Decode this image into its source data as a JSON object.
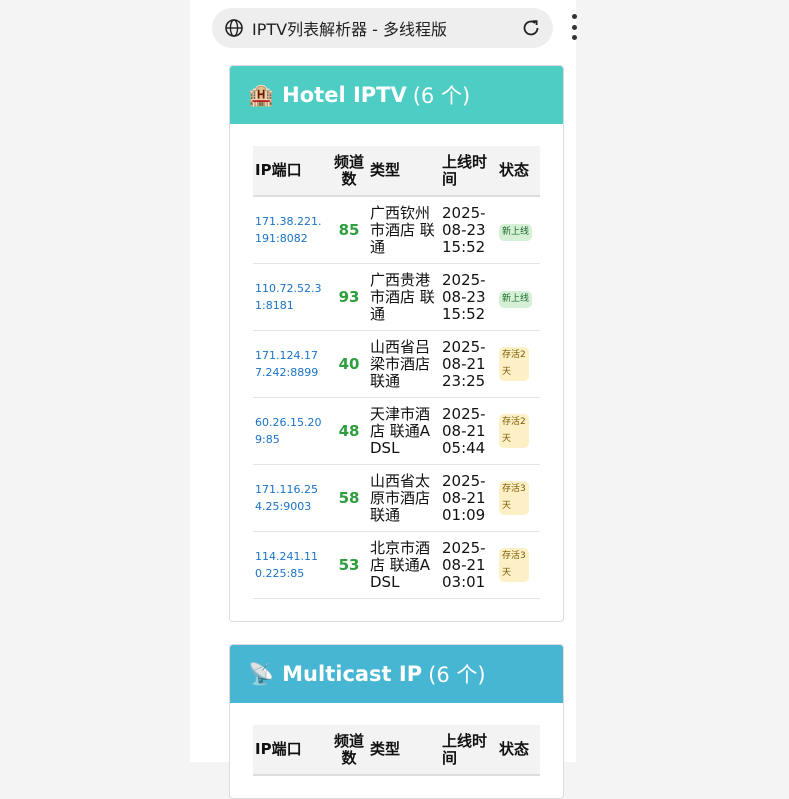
{
  "browser": {
    "title": "IPTV列表解析器 - 多线程版"
  },
  "hotel": {
    "emoji": "🏨",
    "name": "Hotel IPTV",
    "count": "(6 个)",
    "headers": {
      "ip": "IP端口",
      "channels": "频道数",
      "type": "类型",
      "online": "上线时间",
      "status": "状态"
    },
    "rows": [
      {
        "ip": "171.38.221.191:8082",
        "channels": "85",
        "type": "广西钦州市酒店 联通",
        "online": "2025-08-23 15:52",
        "status": "新上线",
        "kind": "new"
      },
      {
        "ip": "110.72.52.31:8181",
        "channels": "93",
        "type": "广西贵港市酒店 联通",
        "online": "2025-08-23 15:52",
        "status": "新上线",
        "kind": "new"
      },
      {
        "ip": "171.124.177.242:8899",
        "channels": "40",
        "type": "山西省吕梁市酒店联通",
        "online": "2025-08-21 23:25",
        "status": "存活2天",
        "kind": "alive"
      },
      {
        "ip": "60.26.15.209:85",
        "channels": "48",
        "type": "天津市酒店 联通ADSL",
        "online": "2025-08-21 05:44",
        "status": "存活2天",
        "kind": "alive"
      },
      {
        "ip": "171.116.254.25:9003",
        "channels": "58",
        "type": "山西省太原市酒店联通",
        "online": "2025-08-21 01:09",
        "status": "存活3天",
        "kind": "alive"
      },
      {
        "ip": "114.241.110.225:85",
        "channels": "53",
        "type": "北京市酒店 联通ADSL",
        "online": "2025-08-21 03:01",
        "status": "存活3天",
        "kind": "alive"
      }
    ]
  },
  "multicast": {
    "emoji": "📡",
    "name": "Multicast IP",
    "count": "(6 个)",
    "headers": {
      "ip": "IP端口",
      "channels": "频道数",
      "type": "类型",
      "online": "上线时间",
      "status": "状态"
    }
  },
  "colors": {
    "hotel_header": "#4ecdc4",
    "multicast_header": "#46b6d3",
    "ip_link": "#1a73c9",
    "channel_count": "#2e9e3e"
  },
  "icons": [
    "globe-icon",
    "reload-icon",
    "more-menu-icon",
    "hotel-emoji-icon",
    "satellite-emoji-icon"
  ]
}
